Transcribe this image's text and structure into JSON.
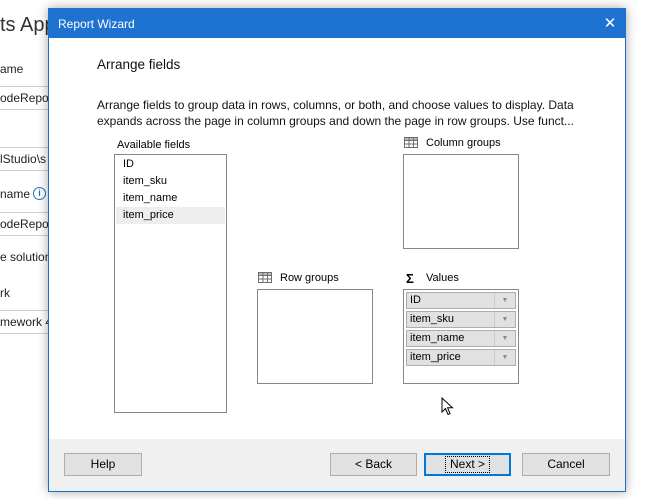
{
  "background_app": {
    "title": "ts App",
    "labels": [
      "ame",
      "e solution",
      "rk"
    ],
    "fields": [
      "odeRepo",
      "lStudio\\s",
      "odeRepo",
      "mework 4"
    ],
    "name_label2": "name"
  },
  "dialog": {
    "title": "Report Wizard",
    "close_glyph": "✕",
    "heading": "Arrange fields",
    "description": "Arrange fields to group data in rows, columns, or both, and choose values to display. Data expands across the page in column groups and down the page in row groups.  Use funct...",
    "available_fields": {
      "label": "Available fields",
      "items": [
        "ID",
        "item_sku",
        "item_name",
        "item_price"
      ]
    },
    "column_groups": {
      "label": "Column groups",
      "icon": "grid-icon"
    },
    "row_groups": {
      "label": "Row groups",
      "icon": "grid-icon"
    },
    "values": {
      "label": "Values",
      "icon": "sigma-icon",
      "icon_glyph": "Σ",
      "items": [
        "ID",
        "item_sku",
        "item_name",
        "item_price"
      ],
      "arrow_glyph": "▼"
    },
    "buttons": {
      "help": "Help",
      "back": "< Back",
      "next": "Next >",
      "cancel": "Cancel"
    }
  }
}
